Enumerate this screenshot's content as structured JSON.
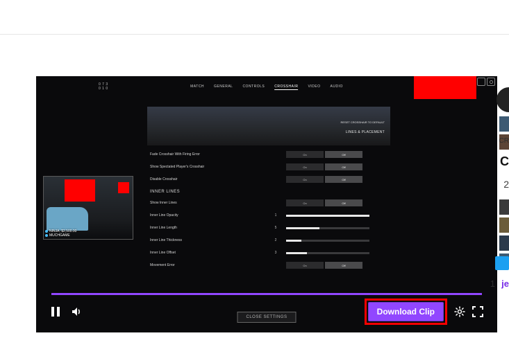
{
  "topbar": {},
  "player": {
    "live_tag": "",
    "score_top": "0 7 3",
    "score_bot": "0 1 0",
    "tabs": [
      "MATCH",
      "GENERAL",
      "CONTROLS",
      "CROSSHAIR",
      "VIDEO",
      "AUDIO"
    ],
    "active_tab": "CROSSHAIR",
    "panel_right_top": "RESET CROSSHAIR TO DEFAULT",
    "panel_right_bot": "LINES & PLACEMENT",
    "settings_rows_a": [
      {
        "label": "Fade Crosshair With Firing Error",
        "val": "",
        "off": "On",
        "on": "Off"
      },
      {
        "label": "Show Spectated Player's Crosshair",
        "val": "",
        "off": "On",
        "on": "Off"
      },
      {
        "label": "Disable Crosshair",
        "val": "",
        "off": "On",
        "on": "Off"
      }
    ],
    "section_title": "INNER LINES",
    "settings_rows_b": [
      {
        "label": "Show Inner Lines",
        "val": "",
        "off": "On",
        "on": "Off",
        "kind": "toggle"
      },
      {
        "label": "Inner Line Opacity",
        "val": "1",
        "kind": "slider",
        "fill": 100
      },
      {
        "label": "Inner Line Length",
        "val": "5",
        "kind": "slider",
        "fill": 40
      },
      {
        "label": "Inner Line Thickness",
        "val": "2",
        "kind": "slider",
        "fill": 18
      },
      {
        "label": "Inner Line Offset",
        "val": "3",
        "kind": "slider",
        "fill": 25
      },
      {
        "label": "Movement Error",
        "val": "",
        "off": "On",
        "on": "Off",
        "kind": "toggle"
      }
    ],
    "pip_line1": "NINJA, $2,500.00",
    "pip_line2": "MUCHGAME",
    "close_settings": "CLOSE SETTINGS",
    "download": "Download Clip"
  },
  "meta": {
    "cr": "CR",
    "title": "C",
    "num": "2",
    "count": "1",
    "link": "je"
  }
}
